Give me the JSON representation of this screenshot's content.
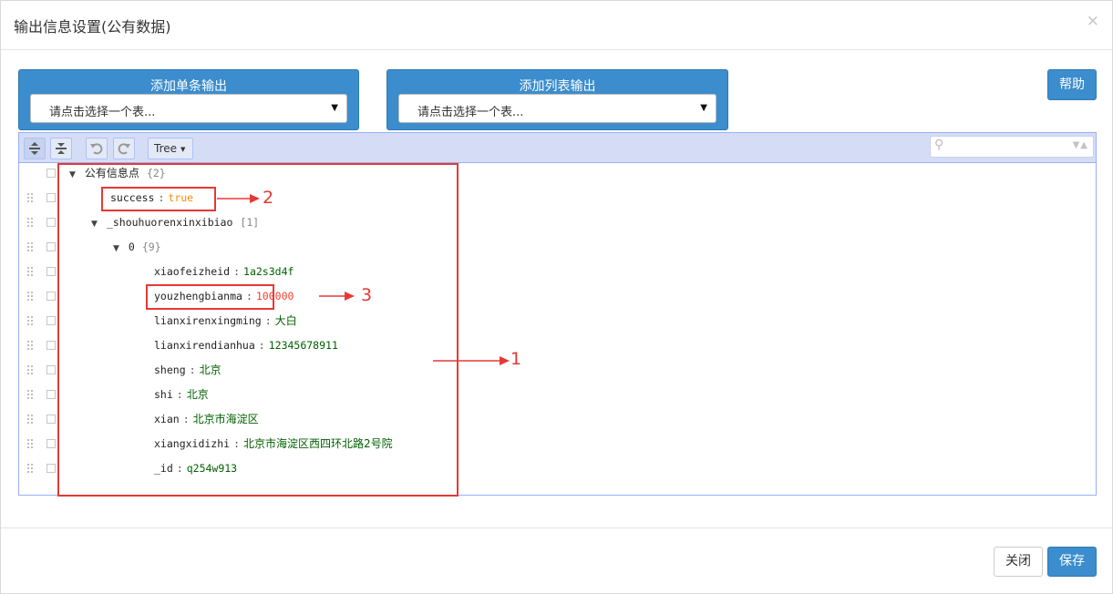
{
  "dialog": {
    "title": "输出信息设置(公有数据)",
    "close_glyph": "×"
  },
  "single_output": {
    "label": "添加单条输出",
    "select_value": "请点击选择一个表..."
  },
  "list_output": {
    "label": "添加列表输出",
    "select_value": "请点击选择一个表..."
  },
  "help_button": "帮助",
  "toolbar": {
    "mode_label": "Tree",
    "mode_caret": "▼",
    "expand_icon": "expand-all-icon",
    "collapse_icon": "collapse-all-icon",
    "undo_icon": "undo-icon",
    "redo_icon": "redo-icon",
    "search_placeholder": ""
  },
  "tree": {
    "root": {
      "key": "公有信息点",
      "count": "{2}"
    },
    "success": {
      "key": "success",
      "value": "true"
    },
    "list": {
      "key": "_shouhuorenxinxibiao",
      "count": "[1]"
    },
    "item0": {
      "key": "0",
      "count": "{9}"
    },
    "fields": [
      {
        "key": "xiaofeizheid",
        "value": "1a2s3d4f"
      },
      {
        "key": "youzhengbianma",
        "value": "100000"
      },
      {
        "key": "lianxirenxingming",
        "value": "大白"
      },
      {
        "key": "lianxirendianhua",
        "value": "12345678911"
      },
      {
        "key": "sheng",
        "value": "北京"
      },
      {
        "key": "shi",
        "value": "北京"
      },
      {
        "key": "xian",
        "value": "北京市海淀区"
      },
      {
        "key": "xiangxidizhi",
        "value": "北京市海淀区西四环北路2号院"
      },
      {
        "key": "_id",
        "value": "q254w913"
      }
    ]
  },
  "annotations": {
    "one": "1",
    "two": "2",
    "three": "3"
  },
  "footer": {
    "close_label": "关闭",
    "save_label": "保存"
  },
  "colors": {
    "primary": "#3c8dcd",
    "annotation": "#e53935",
    "string_value": "#006000",
    "bool_value": "#ff8c00",
    "number_value": "#ee422e"
  }
}
